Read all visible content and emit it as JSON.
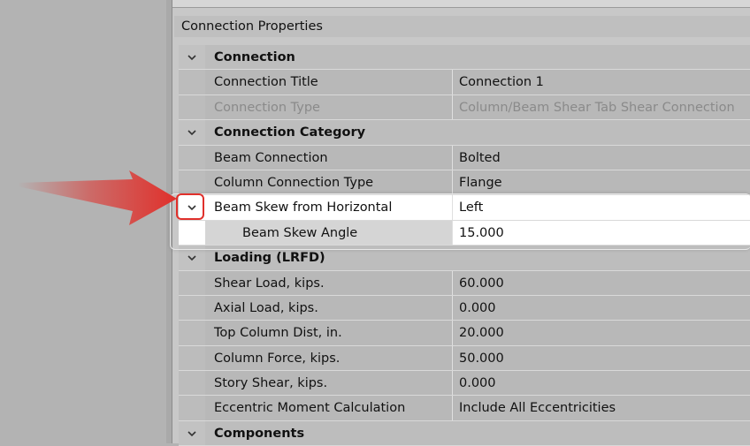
{
  "panel": {
    "title": "Connection Properties"
  },
  "rows": [
    {
      "type": "category",
      "label": "Connection"
    },
    {
      "type": "prop",
      "label": "Connection Title",
      "value": "Connection 1"
    },
    {
      "type": "prop",
      "label": "Connection Type",
      "value": "Column/Beam Shear Tab Shear Connection",
      "disabled": true
    },
    {
      "type": "category",
      "label": "Connection Category"
    },
    {
      "type": "prop",
      "label": "Beam Connection",
      "value": "Bolted"
    },
    {
      "type": "prop",
      "label": "Column Connection Type",
      "value": "Flange"
    },
    {
      "type": "prop",
      "label": "Beam Skew from Horizontal",
      "value": "Left",
      "expandable": true,
      "highlight": true
    },
    {
      "type": "prop",
      "label": "Beam Skew Angle",
      "value": "15.000",
      "indent": 2,
      "highlight": true
    },
    {
      "type": "category",
      "label": "Loading (LRFD)"
    },
    {
      "type": "prop",
      "label": "Shear Load, kips.",
      "value": "60.000"
    },
    {
      "type": "prop",
      "label": "Axial Load, kips.",
      "value": "0.000"
    },
    {
      "type": "prop",
      "label": "Top Column Dist, in.",
      "value": "20.000"
    },
    {
      "type": "prop",
      "label": "Column Force, kips.",
      "value": "50.000"
    },
    {
      "type": "prop",
      "label": "Story Shear, kips.",
      "value": "0.000"
    },
    {
      "type": "prop",
      "label": "Eccentric Moment Calculation",
      "value": "Include All Eccentricities"
    },
    {
      "type": "category",
      "label": "Components"
    }
  ],
  "colors": {
    "highlight_border": "#e0302b",
    "arrow": "#e0302b"
  },
  "icons": {
    "expand": "chevron-down-icon",
    "pointer": "red-arrow"
  }
}
